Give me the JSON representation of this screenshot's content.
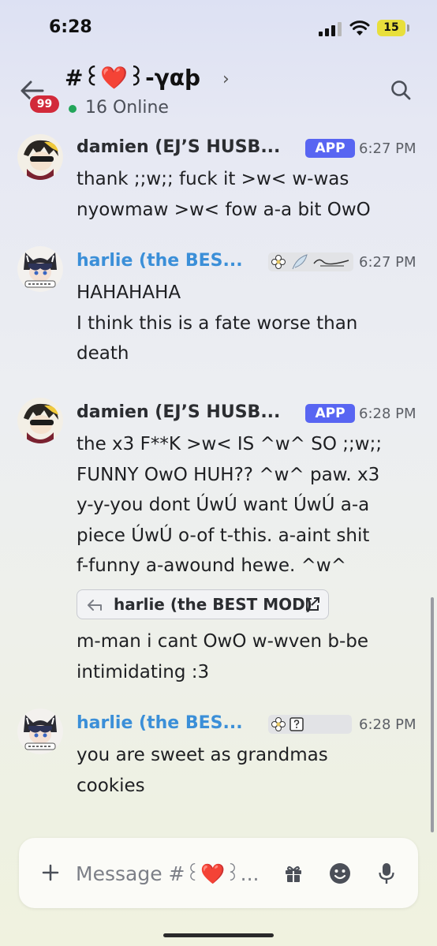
{
  "status_bar": {
    "time": "6:28",
    "battery": "15",
    "colors": {
      "battery": "#e8df3c"
    }
  },
  "header": {
    "back_icon": "arrow-left-icon",
    "unread_badge": "99",
    "channel_prefix": "#",
    "channel_name": "꒰❤️꒱-γαþ",
    "chevron": "›",
    "online_count": "16 Online",
    "search_icon": "search-icon"
  },
  "messages": [
    {
      "author": "damien (EJ’S HUSB...",
      "tag": "APP",
      "time": "6:27 PM",
      "lines": [
        "thank ;;w;; fuck it >w< w-was",
        "nyowmaw >w< fow a-a bit OwO"
      ]
    },
    {
      "author": "harlie (the BES...",
      "time": "6:27 PM",
      "lines": [
        "HAHAHAHA",
        "I think this is a fate worse than",
        "death"
      ]
    },
    {
      "author": "damien (EJ’S HUSB...",
      "tag": "APP",
      "time": "6:28 PM",
      "lines": [
        "the x3 F**K >w< IS ^w^ SO ;;w;;",
        "FUNNY OwO HUH?? ^w^ paw. x3",
        "y-y-you dont ÚwÚ want ÚwÚ a-a",
        "piece ÚwÚ o-of t-this. a-aint shit",
        "f-funny a-awound hewe. ^w^"
      ],
      "reply_chip": "harlie (the BEST MOD)",
      "lines_after": [
        "m-man i cant OwO w-wven b-be",
        "intimidating :3"
      ]
    },
    {
      "author": "harlie (the BES...",
      "time": "6:28 PM",
      "lines": [
        "you are sweet as grandmas",
        "cookies"
      ]
    }
  ],
  "composer": {
    "placeholder": "Message #꒰❤️꒱...",
    "icons": [
      "plus-icon",
      "gift-icon",
      "emoji-icon",
      "mic-icon"
    ]
  },
  "colors": {
    "app_tag": "#5865f2",
    "harlie_name": "#3b8fd8",
    "online": "#23a55a",
    "badge": "#d22a3a"
  }
}
